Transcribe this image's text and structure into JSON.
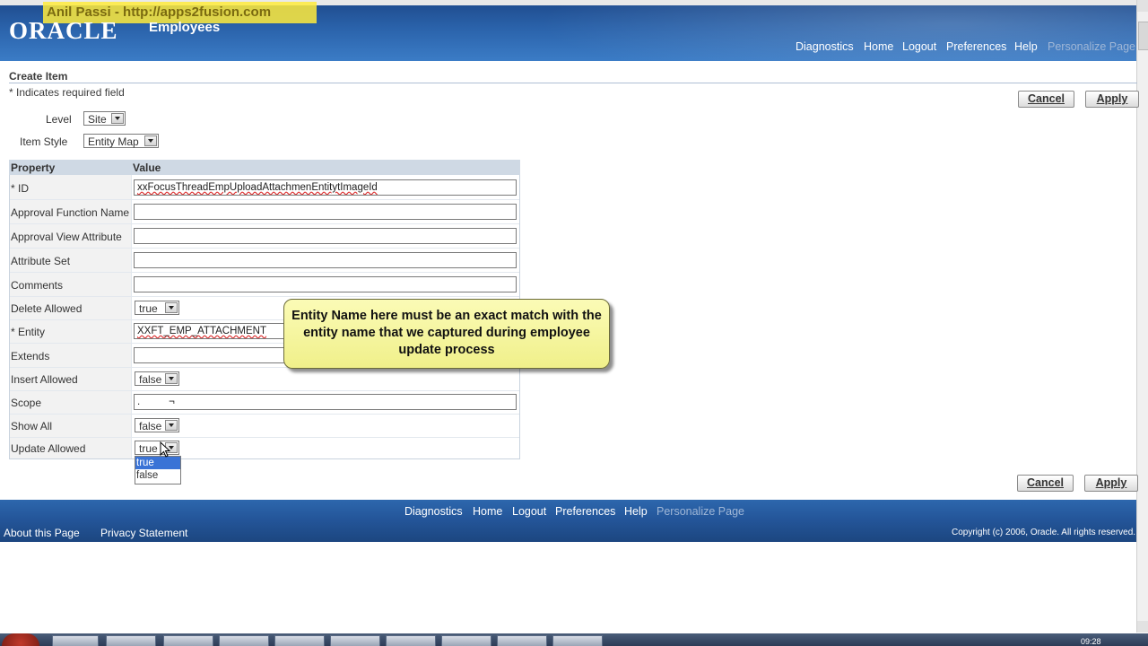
{
  "watermark": "Anil Passi  -  http://apps2fusion.com",
  "header": {
    "logo": "ORACLE",
    "app_name": "Employees",
    "links": [
      "Diagnostics",
      "Home",
      "Logout",
      "Preferences",
      "Help"
    ],
    "personalize": "Personalize Page"
  },
  "page": {
    "title": "Create Item",
    "required_note": "* Indicates required field",
    "cancel_label": "Cancel",
    "apply_label": "Apply",
    "level_label": "Level",
    "level_value": "Site",
    "item_style_label": "Item Style",
    "item_style_value": "Entity Map"
  },
  "table": {
    "headers": [
      "Property",
      "Value"
    ],
    "rows": [
      {
        "label": "* ID",
        "value": "xxFocusThreadEmpUploadAttachmenEntitytImageId"
      },
      {
        "label": "Approval Function Name",
        "value": ""
      },
      {
        "label": "Approval View Attribute",
        "value": ""
      },
      {
        "label": "Attribute Set",
        "value": ""
      },
      {
        "label": "Comments",
        "value": ""
      },
      {
        "label": "Delete Allowed",
        "value": "true"
      },
      {
        "label": "* Entity",
        "value": "XXFT_EMP_ATTACHMENT"
      },
      {
        "label": "Extends",
        "value": ""
      },
      {
        "label": "Insert Allowed",
        "value": "false"
      },
      {
        "label": "Scope",
        "value": ".          ¬"
      },
      {
        "label": "Show All",
        "value": "false"
      },
      {
        "label": "Update Allowed",
        "value": "true"
      }
    ]
  },
  "dropdown_options": [
    "true",
    "false"
  ],
  "callout": "Entity Name here must be an exact match with the entity name that we captured during employee update process",
  "footer": {
    "links": [
      "Diagnostics",
      "Home",
      "Logout",
      "Preferences",
      "Help"
    ],
    "personalize": "Personalize Page",
    "about": "About this Page",
    "privacy": "Privacy Statement",
    "copyright": "Copyright (c) 2006, Oracle. All rights reserved."
  },
  "taskbar": {
    "clock": "09:28"
  }
}
